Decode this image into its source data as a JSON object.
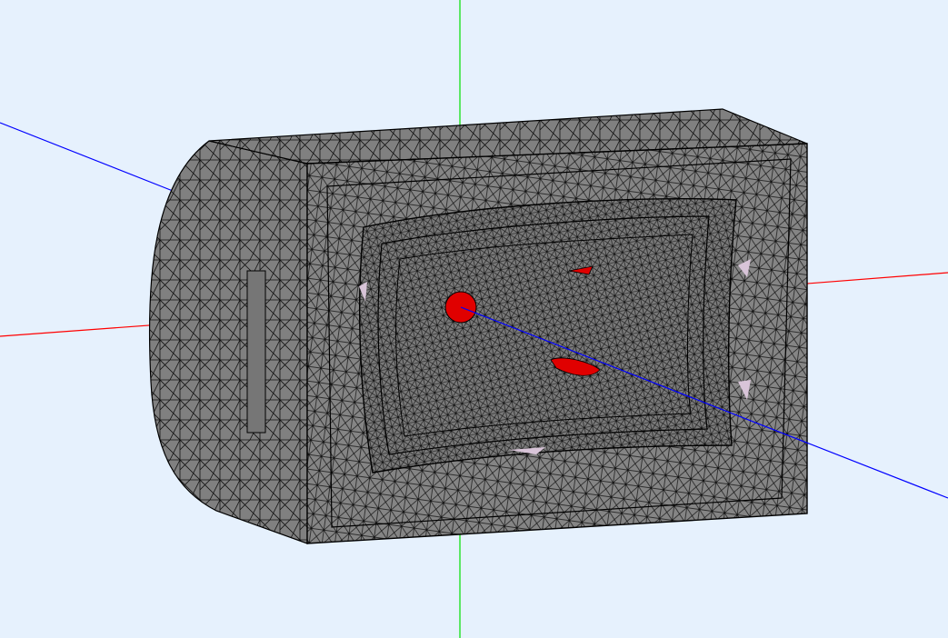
{
  "viewer": {
    "background": "#e6f1fd",
    "axes": {
      "x": {
        "name": "x-axis",
        "color": "#ff0000"
      },
      "y": {
        "name": "y-axis",
        "color": "#00e000"
      },
      "z": {
        "name": "z-axis",
        "color": "#0000ff"
      }
    },
    "model": {
      "name": "horn-loudspeaker-enclosure-mesh",
      "display": "surface-with-wireframe",
      "face_color": "#808080",
      "edge_color": "#000000",
      "highlight_color": "#e00000",
      "port_color": "#d8c4d8"
    }
  }
}
